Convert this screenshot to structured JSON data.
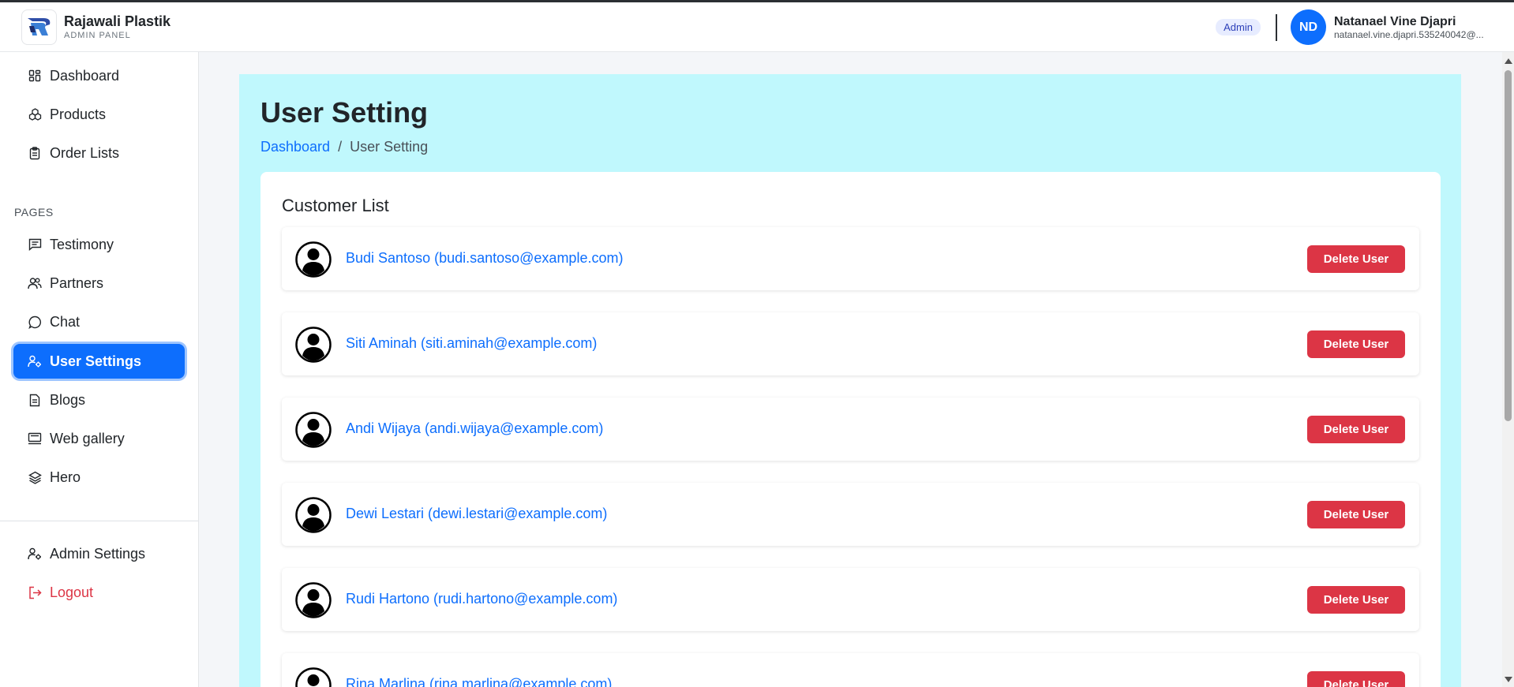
{
  "brand": {
    "name": "Rajawali Plastik",
    "subtitle": "ADMIN PANEL"
  },
  "header": {
    "role_badge": "Admin",
    "user_initials": "ND",
    "user_name": "Natanael Vine Djapri",
    "user_email": "natanael.vine.djapri.535240042@..."
  },
  "sidebar": {
    "section_label": "PAGES",
    "items": [
      {
        "label": "Dashboard",
        "icon": "grid-icon"
      },
      {
        "label": "Products",
        "icon": "boxes-icon"
      },
      {
        "label": "Order Lists",
        "icon": "clipboard-icon"
      },
      {
        "label": "Testimony",
        "icon": "message-icon"
      },
      {
        "label": "Partners",
        "icon": "people-icon"
      },
      {
        "label": "Chat",
        "icon": "chat-icon"
      },
      {
        "label": "User Settings",
        "icon": "user-gear-icon"
      },
      {
        "label": "Blogs",
        "icon": "document-icon"
      },
      {
        "label": "Web gallery",
        "icon": "gallery-icon"
      },
      {
        "label": "Hero",
        "icon": "layers-icon"
      },
      {
        "label": "Admin Settings",
        "icon": "user-gear-icon"
      },
      {
        "label": "Logout",
        "icon": "logout-icon"
      }
    ]
  },
  "main": {
    "title": "User Setting",
    "breadcrumb": {
      "link": "Dashboard",
      "separator": "/",
      "current": "User Setting"
    },
    "card_title": "Customer List",
    "delete_label": "Delete User",
    "customers": [
      "Budi Santoso (budi.santoso@example.com)",
      "Siti Aminah (siti.aminah@example.com)",
      "Andi Wijaya (andi.wijaya@example.com)",
      "Dewi Lestari (dewi.lestari@example.com)",
      "Rudi Hartono (rudi.hartono@example.com)",
      "Rina Marlina (rina.marlina@example.com)"
    ]
  },
  "colors": {
    "primary": "#0d6efd",
    "danger": "#dc3545",
    "content_bg": "#c0f8fd"
  }
}
